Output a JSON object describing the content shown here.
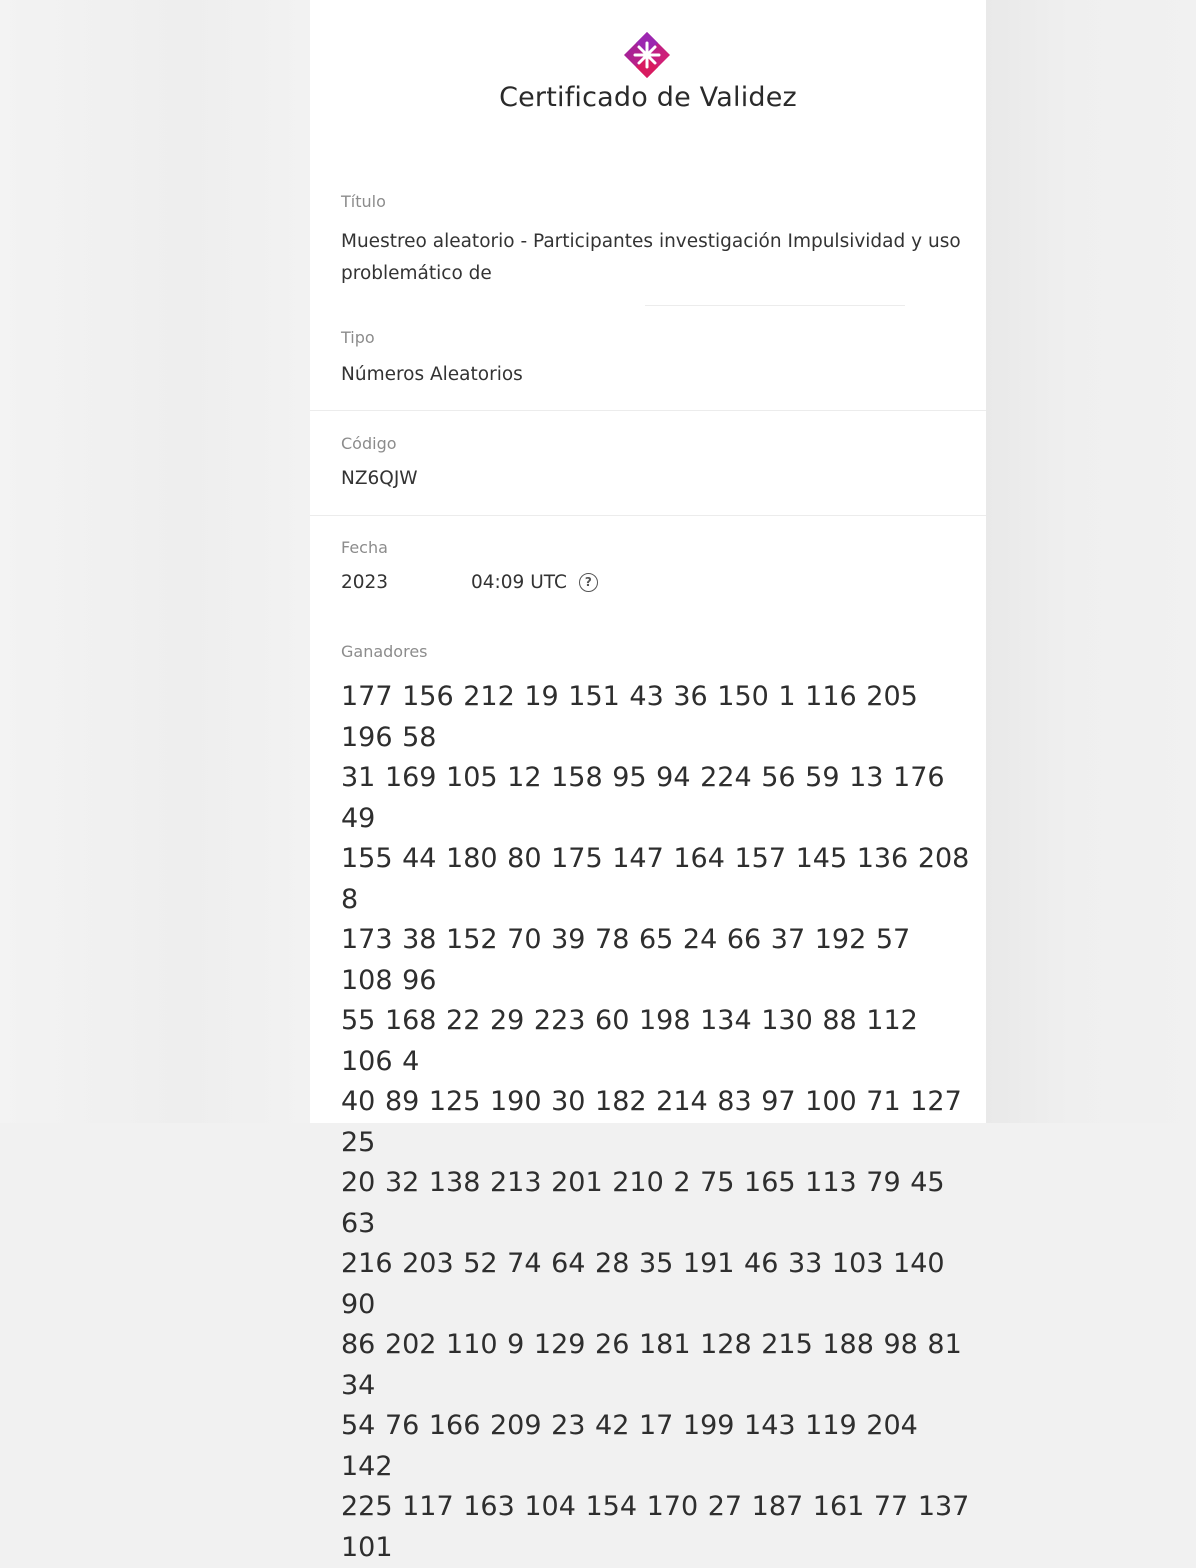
{
  "header": {
    "title": "Certificado de Validez",
    "logo_icon": "diamond-star-logo-icon",
    "brand_color": "#c2185b"
  },
  "fields": {
    "titulo": {
      "label": "Título",
      "value": "Muestreo aleatorio - Participantes investigación Impulsividad y uso problemático de"
    },
    "tipo": {
      "label": "Tipo",
      "value": "Números Aleatorios"
    },
    "codigo": {
      "label": "Código",
      "value": "NZ6QJW"
    },
    "fecha": {
      "label": "Fecha",
      "year": "2023",
      "time": "04:09 UTC",
      "help_icon": "question-circle-icon"
    },
    "ganadores": {
      "label": "Ganadores",
      "lines": [
        "177 156 212 19 151 43 36 150 1 116 205 196 58",
        "31 169 105 12 158 95 94 224 56 59 13 176 49",
        "155 44 180 80 175 147 164 157 145 136 208 8",
        "173 38 152 70 39 78 65 24 66 37 192 57 108 96",
        "55 168 22 29 223 60 198 134 130 88 112 106 4",
        "40 89 125 190 30 182 214 83 97 100 71 127 25",
        "20 32 138 213 201 210 2 75 165 113 79 45 63",
        "216 203 52 74 64 28 35 191 46 33 103 140 90",
        "86 202 110 9 129 26 181 128 215 188 98 81 34",
        "54 76 166 209 23 42 17 199 143 119 204 142",
        "225 117 163 104 154 170 27 187 161 77 137 101"
      ]
    }
  }
}
